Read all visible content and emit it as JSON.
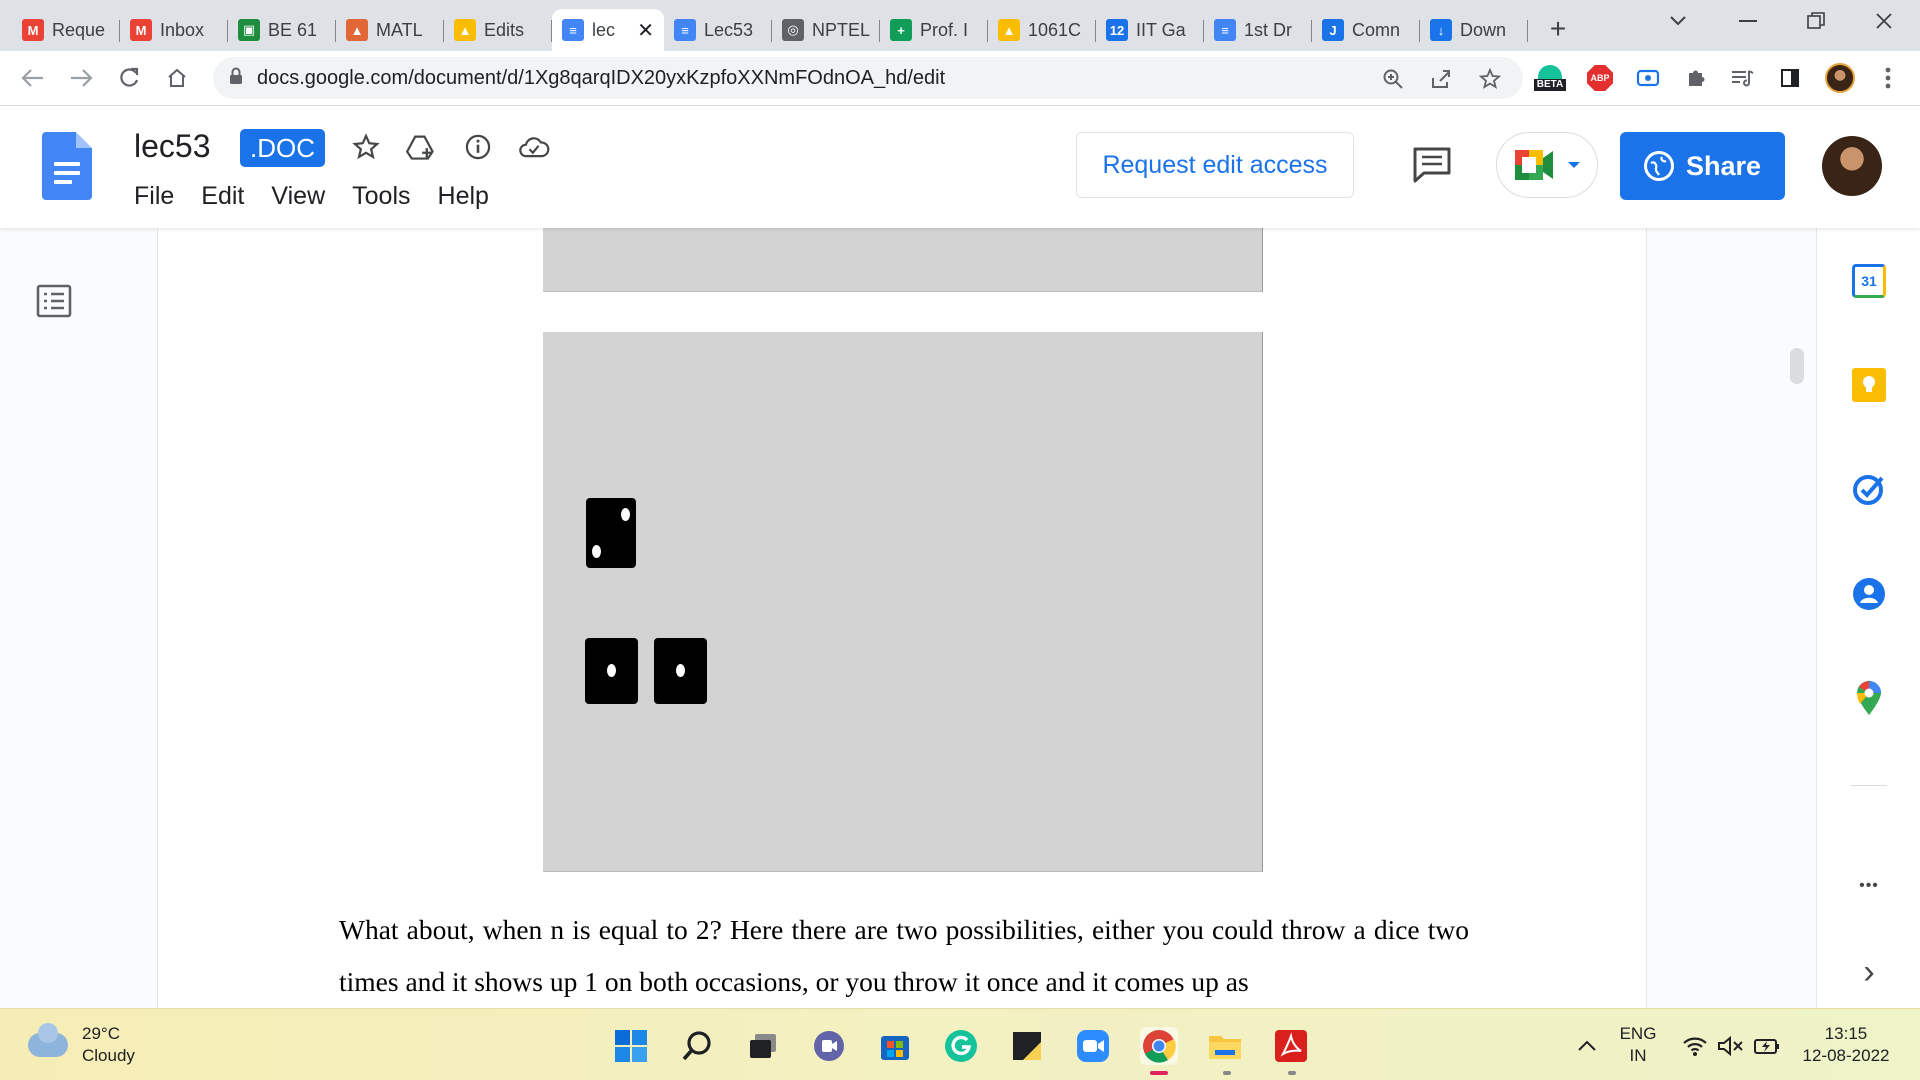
{
  "browser": {
    "tabs": [
      {
        "label": "Reque",
        "icon": "gmail-icon",
        "color": "#ea4335"
      },
      {
        "label": "Inbox",
        "icon": "gmail-icon",
        "color": "#ea4335"
      },
      {
        "label": "BE 61",
        "icon": "classroom-icon",
        "color": "#1e8e3e"
      },
      {
        "label": "MATL",
        "icon": "matlab-icon",
        "color": "#e16737"
      },
      {
        "label": "Edits",
        "icon": "drive-icon",
        "color": "#fbbc04"
      },
      {
        "label": "lec",
        "icon": "docs-icon",
        "color": "#4285f4",
        "active": true
      },
      {
        "label": "Lec53",
        "icon": "docs-icon",
        "color": "#4285f4"
      },
      {
        "label": "NPTEL",
        "icon": "globe-icon",
        "color": "#5f6368"
      },
      {
        "label": "Prof. I",
        "icon": "sheets-icon",
        "color": "#0f9d58"
      },
      {
        "label": "1061C",
        "icon": "drive-icon",
        "color": "#fbbc04"
      },
      {
        "label": "IIT Ga",
        "icon": "calendar-icon",
        "color": "#1a73e8"
      },
      {
        "label": "1st Dr",
        "icon": "docs-icon",
        "color": "#4285f4"
      },
      {
        "label": "Comn",
        "icon": "jamboard-icon",
        "color": "#1a73e8"
      },
      {
        "label": "Down",
        "icon": "download-icon",
        "color": "#1a73e8"
      }
    ],
    "active_tab_close": "✕",
    "new_tab": "+",
    "url": "docs.google.com/document/d/1Xg8qarqIDX20yxKzpfoXXNmFOdnOA_hd/edit",
    "ext_beta": "BETA",
    "ext_abp": "ABP"
  },
  "docs": {
    "title": "lec53",
    "badge": ".DOC",
    "menu": [
      "File",
      "Edit",
      "View",
      "Tools",
      "Help"
    ],
    "request_edit": "Request edit access",
    "share": "Share",
    "accent": "#1a73e8"
  },
  "document": {
    "paragraph": "What about, when n is equal to 2? Here there are two possibilities, either you could throw a dice two times and it shows up 1 on both occasions, or you throw it once and it comes up as"
  },
  "sidepanel": {
    "calendar_day": "31",
    "more": "•••",
    "expand": "›"
  },
  "taskbar": {
    "temperature": "29°C",
    "condition": "Cloudy",
    "lang_top": "ENG",
    "lang_bottom": "IN",
    "time": "13:15",
    "date": "12-08-2022"
  }
}
